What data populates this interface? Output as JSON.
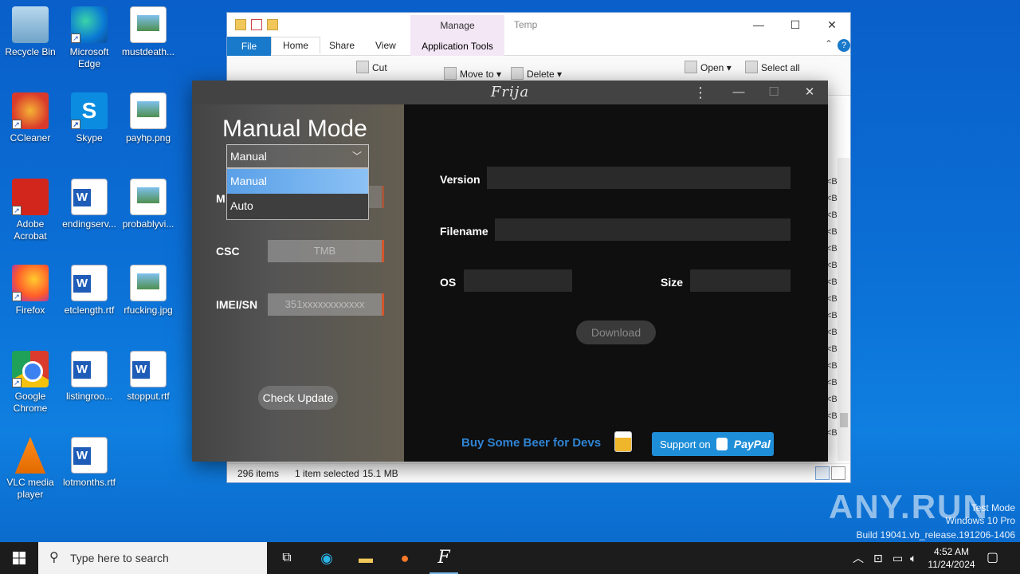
{
  "desktop": {
    "icons": [
      {
        "label": "Recycle Bin",
        "icon": "recycle-bin-icon"
      },
      {
        "label": "Microsoft Edge",
        "icon": "edge-icon"
      },
      {
        "label": "mustdeath...",
        "icon": "image-file-icon"
      },
      {
        "label": "CCleaner",
        "icon": "ccleaner-icon"
      },
      {
        "label": "Skype",
        "icon": "skype-icon"
      },
      {
        "label": "payhp.png",
        "icon": "image-file-icon"
      },
      {
        "label": "Adobe Acrobat",
        "icon": "acrobat-icon"
      },
      {
        "label": "endingserv...",
        "icon": "word-file-icon"
      },
      {
        "label": "probablyvi...",
        "icon": "image-file-icon"
      },
      {
        "label": "Firefox",
        "icon": "firefox-icon"
      },
      {
        "label": "etclength.rtf",
        "icon": "word-file-icon"
      },
      {
        "label": "rfucking.jpg",
        "icon": "image-file-icon"
      },
      {
        "label": "Google Chrome",
        "icon": "chrome-icon"
      },
      {
        "label": "listingroo...",
        "icon": "word-file-icon"
      },
      {
        "label": "stopput.rtf",
        "icon": "word-file-icon"
      },
      {
        "label": "VLC media player",
        "icon": "vlc-icon"
      },
      {
        "label": "lotmonths.rtf",
        "icon": "word-file-icon"
      }
    ]
  },
  "explorer": {
    "title": "Temp",
    "contextual_tab": "Manage",
    "tabs": {
      "file": "File",
      "home": "Home",
      "share": "Share",
      "view": "View",
      "app_tools": "Application Tools"
    },
    "ribbon": {
      "cut": "Cut",
      "move_to": "Move to",
      "delete": "Delete",
      "open": "Open",
      "select_all": "Select all"
    },
    "size_col": [
      "<B",
      "<B",
      "<B",
      "<B",
      "<B",
      "<B",
      "<B",
      "<B",
      "<B",
      "<B",
      "<B",
      "<B",
      "<B",
      "<B",
      "<B",
      "<B"
    ],
    "status": {
      "items": "296 items",
      "selected": "1 item selected",
      "size": "15.1 MB"
    }
  },
  "frija": {
    "title": "Frija",
    "mode_title": "Manual Mode",
    "mode_select": {
      "value": "Manual",
      "options": [
        "Manual",
        "Auto"
      ]
    },
    "hidden_model_label": "M",
    "csc": {
      "label": "CSC",
      "value": "TMB"
    },
    "imei": {
      "label": "IMEI/SN",
      "placeholder": "351xxxxxxxxxxxx"
    },
    "check_update": "Check Update",
    "info": {
      "version": "Version",
      "filename": "Filename",
      "os": "OS",
      "size": "Size"
    },
    "download": "Download",
    "beer": "Buy Some Beer for Devs",
    "paypal": {
      "support": "Support on",
      "brand": "PayPal"
    }
  },
  "watermark": {
    "brand": "ANY.RUN",
    "test_mode": "Test Mode",
    "edition": "Windows 10 Pro",
    "build": "Build 19041.vb_release.191206-1406"
  },
  "taskbar": {
    "search_placeholder": "Type here to search",
    "time": "4:52 AM",
    "date": "11/24/2024"
  },
  "colors": {
    "accent_blue": "#1979ca",
    "frija_orange": "#d2552e",
    "paypal_blue": "#1f8ed8"
  }
}
